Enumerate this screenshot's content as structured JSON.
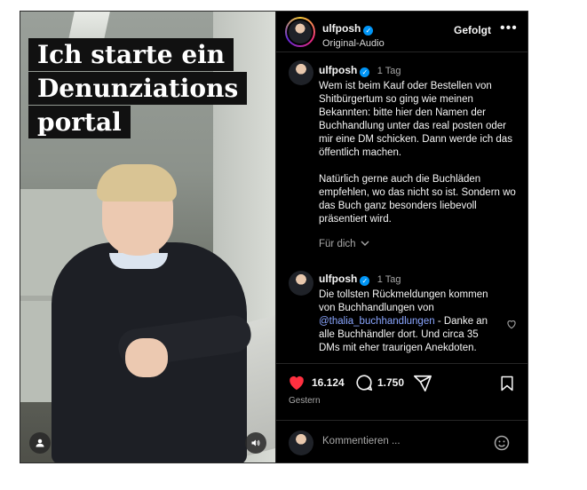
{
  "media": {
    "overlay_lines": [
      "Ich starte ein",
      "Denunziations",
      "portal"
    ],
    "user_tag_icon": "person-icon",
    "audio_icon": "speaker-icon"
  },
  "header": {
    "username": "ulfposh",
    "audio_label": "Original-Audio",
    "follow_label": "Gefolgt",
    "more_icon": "more-icon"
  },
  "caption": {
    "username": "ulfposh",
    "time": "1 Tag",
    "text": "Wem ist beim Kauf oder Bestellen von Shitbürgertum so ging wie meinen Bekannten: bitte hier den Namen der Buchhandlung unter das real posten oder mir eine DM schicken. Dann werde ich das öffentlich machen.\n\nNatürlich gerne auch die Buchläden empfehlen, wo das nicht so ist. Sondern wo das Buch ganz besonders liebevoll präsentiert wird.",
    "for_you": "Für dich"
  },
  "comment": {
    "username": "ulfposh",
    "time": "1 Tag",
    "text_before": "Die tollsten Rückmeldungen kommen von Buchhandlungen von ",
    "mention": "@thalia_buchhandlungen",
    "text_after": " - Danke an alle Buchhändler dort. Und circa 35 DMs mit eher traurigen Anekdoten."
  },
  "actions": {
    "likes": "16.124",
    "comments": "1.750",
    "date": "Gestern"
  },
  "composer": {
    "placeholder": "Kommentieren ..."
  },
  "colors": {
    "like": "#ff3040",
    "verified": "#0095f6",
    "mention": "#8aa6ff"
  }
}
